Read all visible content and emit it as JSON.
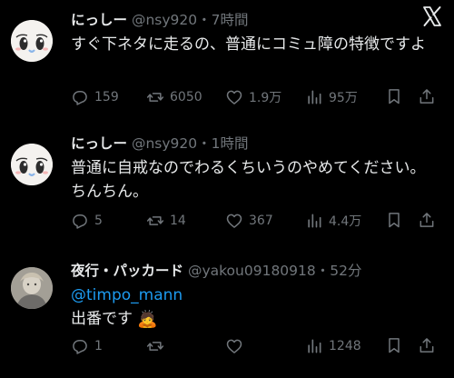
{
  "colors": {
    "background": "#000000",
    "text": "#e7e9ea",
    "muted": "#71767b",
    "link": "#1d9bf0"
  },
  "tweets": [
    {
      "name": "にっしー",
      "meta": "@nsy920・7時間",
      "text": "すぐ下ネタに走るの、普通にコミュ障の特徴ですよ",
      "replies": "159",
      "reposts": "6050",
      "likes": "1.9万",
      "views": "95万",
      "avatar_icon": "cartoon-face-avatar"
    },
    {
      "name": "にっしー",
      "meta": "@nsy920・1時間",
      "text": "普通に自戒なのでわるくちいうのやめてください。ちんちん。",
      "replies": "5",
      "reposts": "14",
      "likes": "367",
      "views": "4.4万",
      "avatar_icon": "cartoon-face-avatar"
    },
    {
      "name": "夜行・パッカード",
      "meta": "@yakou09180918・52分",
      "mention": "@timpo_mann",
      "text": "出番です",
      "emoji": "🙇",
      "replies": "1",
      "reposts": "",
      "likes": "",
      "views": "1248",
      "avatar_icon": "photo-avatar"
    }
  ],
  "icons": [
    "x-logo-icon",
    "reply-icon",
    "repost-icon",
    "like-icon",
    "views-icon",
    "bookmark-icon",
    "share-icon"
  ]
}
